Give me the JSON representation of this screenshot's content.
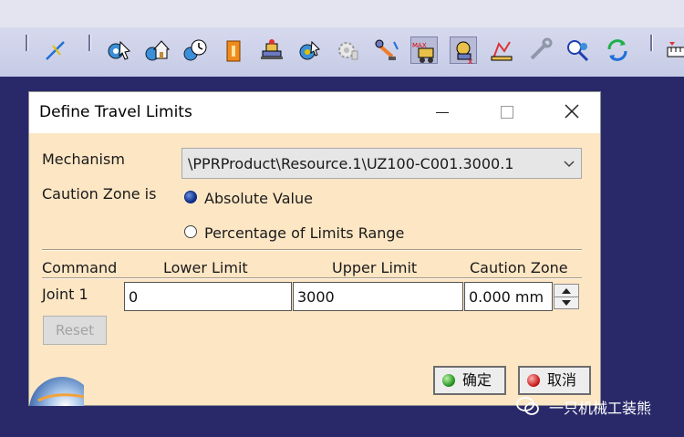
{
  "toolbar": {
    "icons": [
      "line-icon",
      "pointer-gear-icon",
      "home-gear-icon",
      "clock-gear-icon",
      "orange-panel-icon",
      "robot-gear-icon",
      "gear-pointer-icon",
      "gear-gray-icon",
      "robot-arm-icon",
      "limits-max-icon",
      "limits-robot-icon",
      "sim-robot-icon",
      "wrench-icon",
      "gear-magnify-icon",
      "refresh-icon",
      "ruler-icon"
    ]
  },
  "dialog": {
    "title": "Define Travel Limits",
    "mechanism_label": "Mechanism",
    "mechanism_value": "\\PPRProduct\\Resource.1\\UZ100-C001.3000.1",
    "caution_zone_label": "Caution Zone is",
    "options": {
      "absolute": "Absolute Value",
      "percentage": "Percentage of Limits Range"
    },
    "selected_option": "absolute",
    "table": {
      "headers": [
        "Command",
        "Lower Limit",
        "Upper Limit",
        "Caution Zone"
      ],
      "rows": [
        {
          "command": "Joint 1",
          "lower": "0",
          "upper": "3000",
          "caution": "0.000 mm"
        }
      ]
    },
    "reset_label": "Reset",
    "ok_label": "确定",
    "cancel_label": "取消"
  },
  "watermark": {
    "text": "一只机械工装熊"
  },
  "colors": {
    "desktop": "#29296a",
    "dialog_bg": "#fde6c4",
    "toolbar_bg": "#cdd1ea"
  }
}
